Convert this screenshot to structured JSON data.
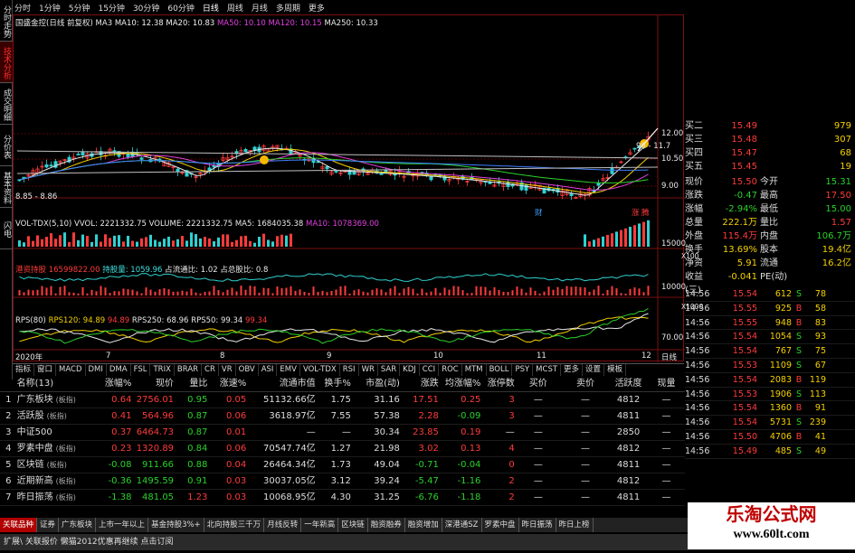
{
  "vtabs": [
    "分时走势",
    "技术分析",
    "成交明细",
    "分价表",
    "基本资料",
    "闪电"
  ],
  "periods": [
    "分时",
    "1分钟",
    "5分钟",
    "15分钟",
    "30分钟",
    "60分钟",
    "日线",
    "周线",
    "月线",
    "多周期",
    "更多"
  ],
  "main": {
    "title": "国盛金控(日线 前复权)",
    "ma": [
      {
        "label": "MA3",
        "color": "#e8e8e8"
      },
      {
        "label": "MA10: 12.38",
        "color": "#f0f0f0"
      },
      {
        "label": "MA20: 10.83",
        "color": "#f0f0f0"
      },
      {
        "label": "MA50: 10.10",
        "color": "#e040e0"
      },
      {
        "label": "MA120: 10.15",
        "color": "#e040e0"
      },
      {
        "label": "MA250: 10.33",
        "color": "#e8e8e8"
      }
    ],
    "price_ticks": [
      "12.00",
      "10.50",
      "9.00"
    ],
    "low_label": "8.85 - 8.86",
    "high_label": "96 - 11.7",
    "markers": [
      "财",
      "涨",
      "腾"
    ],
    "vol_line": "VOL-TDX(5,10)  VVOL: 2221332.75  VOLUME: 2221332.75  MA5: 1684035.38",
    "vol_ma10": "MA10: 1078369.00",
    "vol_tick1": "15000",
    "vol_unit": "X100",
    "hk_line": "港资持股",
    "hk_val": "16599822.00",
    "hk_hold": "持股量: 1059.96",
    "hk_ratio": "占流通比: 1.02  占总股比: 0.8",
    "hk_tick": "10000",
    "hk_unit": "X1000",
    "rps_line": "RPS(80)",
    "rps_120": "RPS120: 94.89",
    "rps_x": "94.89",
    "rps_250": "RPS250: 68.96  RPS50: 99.34",
    "rps_last": "99.34",
    "rps_tick": "70.00",
    "x_labels": [
      "2020年",
      "7",
      "8",
      "9",
      "10",
      "11",
      "12"
    ],
    "x_unit": "日线"
  },
  "indicators": [
    "指标",
    "窗口",
    "MACD",
    "DMI",
    "DMA",
    "FSL",
    "TRIX",
    "BRAR",
    "CR",
    "VR",
    "OBV",
    "ASI",
    "EMV",
    "VOL-TDX",
    "RSI",
    "WR",
    "SAR",
    "KDJ",
    "CCI",
    "ROC",
    "MTM",
    "BOLL",
    "PSY",
    "MCST",
    "更多",
    "设置",
    "模板"
  ],
  "right": {
    "asks": [
      {
        "label": "买二",
        "price": "15.49",
        "vol": "979"
      },
      {
        "label": "买三",
        "price": "15.48",
        "vol": "307"
      },
      {
        "label": "买四",
        "price": "15.47",
        "vol": "68"
      },
      {
        "label": "买五",
        "price": "15.45",
        "vol": "19"
      }
    ],
    "quote": [
      {
        "a": "现价",
        "b": "15.50",
        "bc": "#ff3b3b",
        "c": "今开",
        "d": "15.31",
        "dc": "#2bd12b"
      },
      {
        "a": "涨跌",
        "b": "-0.47",
        "bc": "#2bd12b",
        "c": "最高",
        "d": "17.50",
        "dc": "#ff3b3b"
      },
      {
        "a": "涨幅",
        "b": "-2.94%",
        "bc": "#2bd12b",
        "c": "最低",
        "d": "15.00",
        "dc": "#2bd12b"
      },
      {
        "a": "总量",
        "b": "222.1万",
        "bc": "#f5d100",
        "c": "量比",
        "d": "1.57",
        "dc": "#ff3b3b"
      },
      {
        "a": "外盘",
        "b": "115.4万",
        "bc": "#ff3b3b",
        "c": "内盘",
        "d": "106.7万",
        "dc": "#2bd12b"
      },
      {
        "a": "换手",
        "b": "13.69%",
        "bc": "#f5d100",
        "c": "股本",
        "d": "19.4亿",
        "dc": "#f5d100"
      },
      {
        "a": "净资",
        "b": "5.91",
        "bc": "#f5d100",
        "c": "流通",
        "d": "16.2亿",
        "dc": "#f5d100"
      },
      {
        "a": "收益(三)",
        "b": "-0.041",
        "bc": "#f5d100",
        "c": "PE(动)",
        "d": "",
        "dc": "#f5d100"
      }
    ],
    "ticks": [
      {
        "t": "14:56",
        "p": "15.54",
        "v": "612",
        "s": "S",
        "sc": "#2bd12b",
        "n": "78"
      },
      {
        "t": "14:56",
        "p": "15.55",
        "v": "925",
        "s": "B",
        "sc": "#ff3b3b",
        "n": "58"
      },
      {
        "t": "14:56",
        "p": "15.55",
        "v": "948",
        "s": "B",
        "sc": "#ff3b3b",
        "n": "83"
      },
      {
        "t": "14:56",
        "p": "15.54",
        "v": "1054",
        "s": "S",
        "sc": "#2bd12b",
        "n": "93"
      },
      {
        "t": "14:56",
        "p": "15.54",
        "v": "767",
        "s": "S",
        "sc": "#2bd12b",
        "n": "75"
      },
      {
        "t": "14:56",
        "p": "15.53",
        "v": "1109",
        "s": "S",
        "sc": "#2bd12b",
        "n": "67"
      },
      {
        "t": "14:56",
        "p": "15.54",
        "v": "2083",
        "s": "B",
        "sc": "#ff3b3b",
        "n": "119"
      },
      {
        "t": "14:56",
        "p": "15.53",
        "v": "1906",
        "s": "S",
        "sc": "#2bd12b",
        "n": "113"
      },
      {
        "t": "14:56",
        "p": "15.54",
        "v": "1360",
        "s": "B",
        "sc": "#ff3b3b",
        "n": "91"
      },
      {
        "t": "14:56",
        "p": "15.54",
        "v": "5731",
        "s": "S",
        "sc": "#2bd12b",
        "n": "239"
      },
      {
        "t": "14:56",
        "p": "15.50",
        "v": "4706",
        "s": "B",
        "sc": "#ff3b3b",
        "n": "41"
      },
      {
        "t": "14:56",
        "p": "15.49",
        "v": "485",
        "s": "S",
        "sc": "#2bd12b",
        "n": "49"
      }
    ]
  },
  "table": {
    "headers": [
      "",
      "名称(13)",
      "涨幅%",
      "现价",
      "量比",
      "涨速%",
      "流通市值",
      "换手%",
      "市盈(动)",
      "涨跌",
      "均涨幅%",
      "涨停数",
      "买价",
      "卖价",
      "活跃度",
      "现量"
    ],
    "rows": [
      {
        "no": "1",
        "name": "广东板块",
        "tag": "(板指)",
        "chg": "0.64",
        "chgc": "#ff3b3b",
        "price": "2756.01",
        "pc": "#ff3b3b",
        "vr": "0.95",
        "vrc": "#2bd12b",
        "spd": "0.05",
        "sc": "#ff3b3b",
        "cap": "51132.66亿",
        "turn": "1.75",
        "pe": "31.16",
        "ud": "17.51",
        "udc": "#ff3b3b",
        "avg": "0.25",
        "avc": "#ff3b3b",
        "lim": "3",
        "lc": "#ff3b3b",
        "bid": "—",
        "ask": "—",
        "act": "4812",
        "cur": "—"
      },
      {
        "no": "2",
        "name": "活跃股",
        "tag": "(板指)",
        "chg": "0.41",
        "chgc": "#ff3b3b",
        "price": "564.96",
        "pc": "#ff3b3b",
        "vr": "0.87",
        "vrc": "#2bd12b",
        "spd": "0.06",
        "sc": "#ff3b3b",
        "cap": "3618.97亿",
        "turn": "7.55",
        "pe": "57.38",
        "ud": "2.28",
        "udc": "#ff3b3b",
        "avg": "-0.09",
        "avc": "#2bd12b",
        "lim": "3",
        "lc": "#ff3b3b",
        "bid": "—",
        "ask": "—",
        "act": "4811",
        "cur": "—"
      },
      {
        "no": "3",
        "name": "中证500",
        "tag": "",
        "chg": "0.37",
        "chgc": "#ff3b3b",
        "price": "6464.73",
        "pc": "#ff3b3b",
        "vr": "0.87",
        "vrc": "#2bd12b",
        "spd": "0.01",
        "sc": "#ff3b3b",
        "cap": "—",
        "turn": "—",
        "pe": "30.34",
        "ud": "23.85",
        "udc": "#ff3b3b",
        "avg": "0.19",
        "avc": "#ff3b3b",
        "lim": "—",
        "lc": "#ddd",
        "bid": "—",
        "ask": "—",
        "act": "2850",
        "cur": "—"
      },
      {
        "no": "4",
        "name": "罗素中盘",
        "tag": "(板指)",
        "chg": "0.23",
        "chgc": "#ff3b3b",
        "price": "1320.89",
        "pc": "#ff3b3b",
        "vr": "0.84",
        "vrc": "#2bd12b",
        "spd": "0.06",
        "sc": "#ff3b3b",
        "cap": "70547.74亿",
        "turn": "1.27",
        "pe": "21.98",
        "ud": "3.02",
        "udc": "#ff3b3b",
        "avg": "0.13",
        "avc": "#ff3b3b",
        "lim": "4",
        "lc": "#ff3b3b",
        "bid": "—",
        "ask": "—",
        "act": "4812",
        "cur": "—"
      },
      {
        "no": "5",
        "name": "区块链",
        "tag": "(板指)",
        "chg": "-0.08",
        "chgc": "#2bd12b",
        "price": "911.66",
        "pc": "#2bd12b",
        "vr": "0.88",
        "vrc": "#2bd12b",
        "spd": "0.04",
        "sc": "#ff3b3b",
        "cap": "26464.34亿",
        "turn": "1.73",
        "pe": "49.04",
        "ud": "-0.71",
        "udc": "#2bd12b",
        "avg": "-0.04",
        "avc": "#2bd12b",
        "lim": "0",
        "lc": "#ff3b3b",
        "bid": "—",
        "ask": "—",
        "act": "4811",
        "cur": "—"
      },
      {
        "no": "6",
        "name": "近期新高",
        "tag": "(板指)",
        "chg": "-0.36",
        "chgc": "#2bd12b",
        "price": "1495.59",
        "pc": "#2bd12b",
        "vr": "0.91",
        "vrc": "#2bd12b",
        "spd": "0.03",
        "sc": "#ff3b3b",
        "cap": "30037.05亿",
        "turn": "3.12",
        "pe": "39.24",
        "ud": "-5.47",
        "udc": "#2bd12b",
        "avg": "-1.16",
        "avc": "#2bd12b",
        "lim": "2",
        "lc": "#ff3b3b",
        "bid": "—",
        "ask": "—",
        "act": "4812",
        "cur": "—"
      },
      {
        "no": "7",
        "name": "昨日振荡",
        "tag": "(板指)",
        "chg": "-1.38",
        "chgc": "#2bd12b",
        "price": "481.05",
        "pc": "#2bd12b",
        "vr": "1.23",
        "vrc": "#ff3b3b",
        "spd": "0.03",
        "sc": "#ff3b3b",
        "cap": "10068.95亿",
        "turn": "4.30",
        "pe": "31.25",
        "ud": "-6.76",
        "udc": "#2bd12b",
        "avg": "-1.18",
        "avc": "#2bd12b",
        "lim": "2",
        "lc": "#ff3b3b",
        "bid": "—",
        "ask": "—",
        "act": "4811",
        "cur": "—"
      }
    ]
  },
  "bottom_tabs": [
    "关联品种",
    "证券",
    "广东板块",
    "上市一年以上",
    "基金持股3%+",
    "北向持股三千万",
    "月线反转",
    "一年新高",
    "区块链",
    "融资融券",
    "融资增加",
    "深港通SZ",
    "罗素中盘",
    "昨日振荡",
    "昨日上榜"
  ],
  "status": "扩展\\  关联报价  懒猫2012优惠再继续 点击订阅",
  "logo": {
    "l1": "乐淘公式网",
    "l2": "www.60lt.com"
  }
}
